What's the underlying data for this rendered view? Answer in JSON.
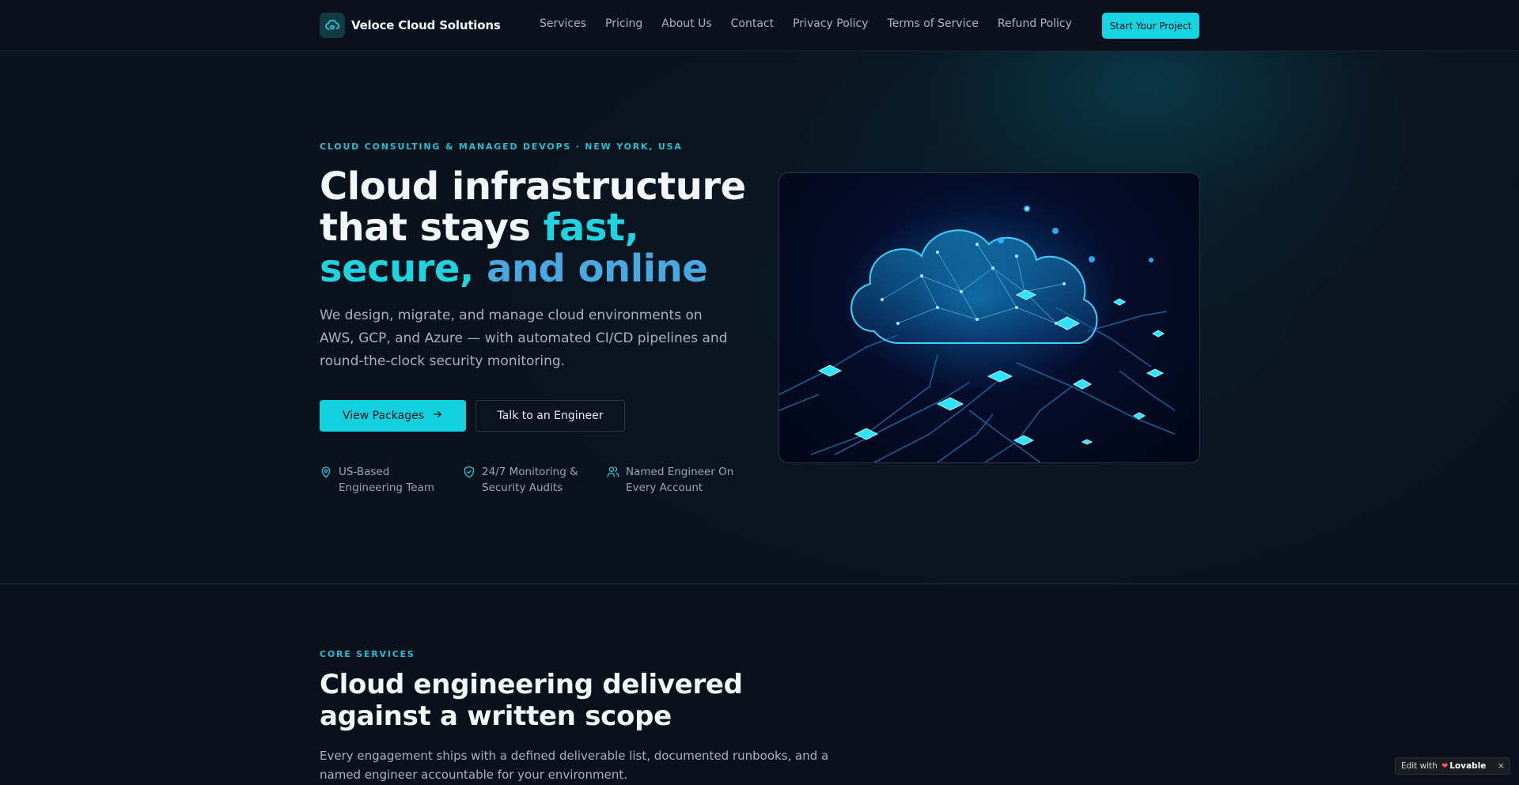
{
  "brand": {
    "name": "Veloce Cloud Solutions",
    "logo_icon": "cloud-icon"
  },
  "nav": {
    "links": [
      "Services",
      "Pricing",
      "About Us",
      "Contact",
      "Privacy Policy",
      "Terms of Service",
      "Refund Policy"
    ],
    "cta_label": "Start Your Project"
  },
  "hero": {
    "eyebrow": "CLOUD CONSULTING & MANAGED DEVOPS · NEW YORK, USA",
    "title_part1": "Cloud infrastructure that stays ",
    "title_highlight1": "fast, secure,",
    "title_highlight2": "and online",
    "description": "We design, migrate, and manage cloud environments on AWS, GCP, and Azure — with automated CI/CD pipelines and round-the-clock security monitoring.",
    "primary_button": "View Packages",
    "secondary_button": "Talk to an Engineer",
    "features": [
      {
        "icon": "map-pin-icon",
        "text": "US-Based Engineering Team"
      },
      {
        "icon": "shield-check-icon",
        "text": "24/7 Monitoring & Security Audits"
      },
      {
        "icon": "users-icon",
        "text": "Named Engineer On Every Account"
      }
    ]
  },
  "services": {
    "eyebrow": "CORE SERVICES",
    "title": "Cloud engineering delivered against a written scope",
    "description": "Every engagement ships with a defined deliverable list, documented runbooks, and a named engineer accountable for your environment."
  },
  "badge": {
    "prefix": "Edit with",
    "brand": "Lovable",
    "close": "×"
  },
  "colors": {
    "accent": "#13d0de",
    "accent_blue": "#4aa8e0",
    "background": "#0a111c",
    "muted_text": "#a7b3c0"
  }
}
